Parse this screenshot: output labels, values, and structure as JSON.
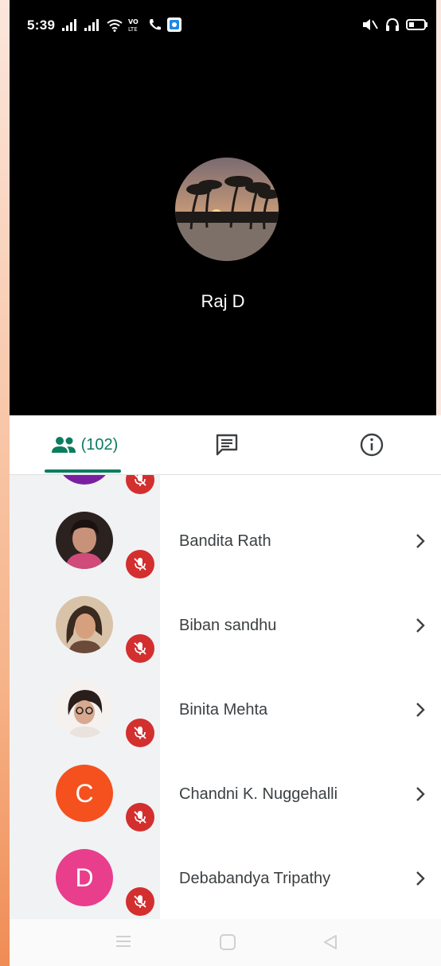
{
  "status_bar": {
    "time": "5:39",
    "network_label_top": "VO LTE",
    "icons": [
      "signal-icon",
      "signal-icon",
      "wifi-icon",
      "volte-icon",
      "wifi-calling-icon",
      "app-notification-icon",
      "mute-icon",
      "headphones-icon",
      "battery-icon"
    ]
  },
  "speaker": {
    "name": "Raj D"
  },
  "tabs": {
    "participants_count": "(102)",
    "active_color": "#0b7d5f"
  },
  "participants": [
    {
      "name": "",
      "initial": "",
      "avatar_color": "#7b1fa2",
      "muted": true
    },
    {
      "name": "Bandita Rath",
      "initial": "",
      "avatar_color": "#3b2a26",
      "muted": true
    },
    {
      "name": "Biban sandhu",
      "initial": "",
      "avatar_color": "#b48a64",
      "muted": true
    },
    {
      "name": "Binita Mehta",
      "initial": "",
      "avatar_color": "#e6d6c8",
      "muted": true
    },
    {
      "name": "Chandni K. Nuggehalli",
      "initial": "C",
      "avatar_color": "#f4511e",
      "muted": true
    },
    {
      "name": "Debabandya Tripathy",
      "initial": "D",
      "avatar_color": "#e83e8c",
      "muted": true
    }
  ],
  "colors": {
    "mute_badge": "#d32f2f",
    "list_gray": "#f1f2f4"
  }
}
